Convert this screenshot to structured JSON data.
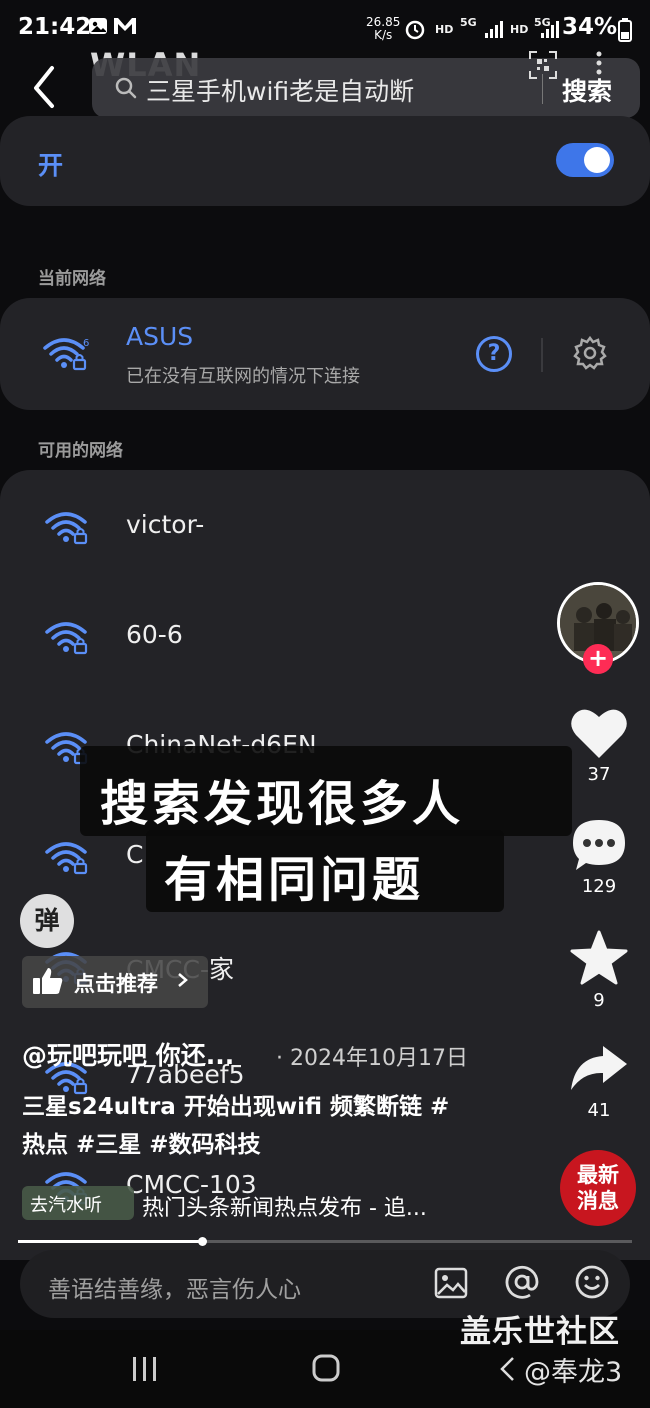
{
  "status": {
    "time": "21:42",
    "net_speed_top": "26.85",
    "net_speed_bottom": "K/s",
    "hd1": "HD",
    "fiveg1": "5G",
    "hd2": "HD",
    "fiveg2": "5G",
    "battery": "34%"
  },
  "header": {
    "title": "WLAN",
    "search_query": "三星手机wifi老是自动断",
    "search_button": "搜索"
  },
  "wlan": {
    "toggle_label": "开",
    "toggle_on": true,
    "current_section": "当前网络",
    "current_network": {
      "name": "ASUS",
      "status": "已在没有互联网的情况下连接"
    },
    "available_section": "可用的网络",
    "available_networks": [
      "victor-",
      "60-6",
      "ChinaNet-d6EN",
      "C",
      "CMCC-家",
      "77abeef5",
      "CMCC-103"
    ]
  },
  "overlay": {
    "line1": "搜索发现很多人",
    "line2": "有相同问题"
  },
  "video": {
    "danmaku_button": "弹",
    "recommend_label": "点击推荐",
    "author": "@玩吧玩吧 你还...",
    "date": "· 2024年10月17日",
    "description_line1": "三星s24ultra 开始出现wifi 频繁断链 #",
    "description_line2": "热点 #三星 #数码科技",
    "tag": "去汽水听",
    "news_line": "热门头条新闻热点发布 - 追...",
    "progress": 0.3,
    "comment_placeholder": "善语结善缘，恶言伤人心"
  },
  "rail": {
    "likes": "37",
    "comments": "129",
    "favorites": "9",
    "shares": "41",
    "news_badge_line1": "最新",
    "news_badge_line2": "消息"
  },
  "watermark": {
    "site": "盖乐世社区",
    "user": "@奉龙3"
  },
  "colors": {
    "accent": "#5b8ff7",
    "toggle": "#3e76e9",
    "like_red": "#fe2c55",
    "news_red": "#c8161f"
  }
}
